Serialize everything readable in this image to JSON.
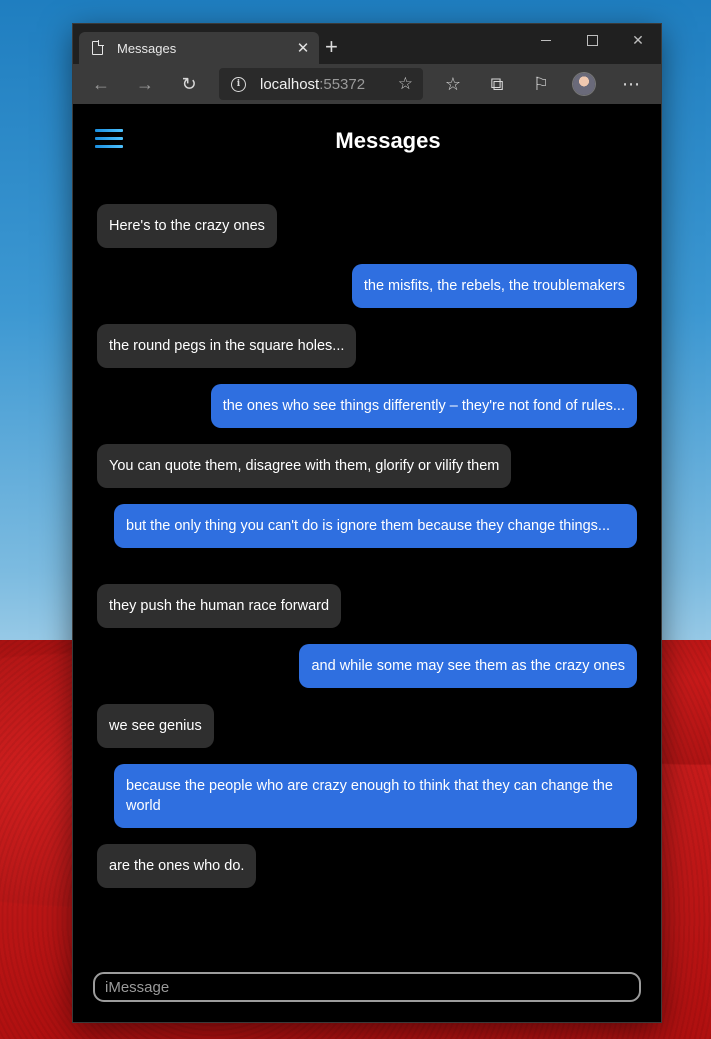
{
  "browser": {
    "tab_title": "Messages",
    "tab_close": "✕",
    "new_tab": "+",
    "url_host": "localhost",
    "url_port": ":55372"
  },
  "app": {
    "title": "Messages",
    "input_placeholder": "iMessage"
  },
  "messages": [
    {
      "from": "them",
      "text": "Here's to the crazy ones"
    },
    {
      "from": "me",
      "text": "the misfits, the rebels, the troublemakers"
    },
    {
      "from": "them",
      "text": "the round pegs in the square holes..."
    },
    {
      "from": "me",
      "text": "the ones who see things differently – they're not fond of rules..."
    },
    {
      "from": "them",
      "text": "You can quote them, disagree with them, glorify or vilify them"
    },
    {
      "from": "me",
      "text": "but the only thing you can't do is ignore them because they change things..."
    },
    {
      "from": "them",
      "text": "they push the human race forward"
    },
    {
      "from": "me",
      "text": "and while some may see them as the crazy ones"
    },
    {
      "from": "them",
      "text": "we see genius"
    },
    {
      "from": "me",
      "text": "because the people who are crazy enough to think that they can change the world"
    },
    {
      "from": "them",
      "text": "are the ones who do."
    }
  ],
  "colors": {
    "incoming_bubble": "#2f2f2f",
    "outgoing_bubble": "#2f6fe0",
    "accent": "#1b8fe0"
  }
}
